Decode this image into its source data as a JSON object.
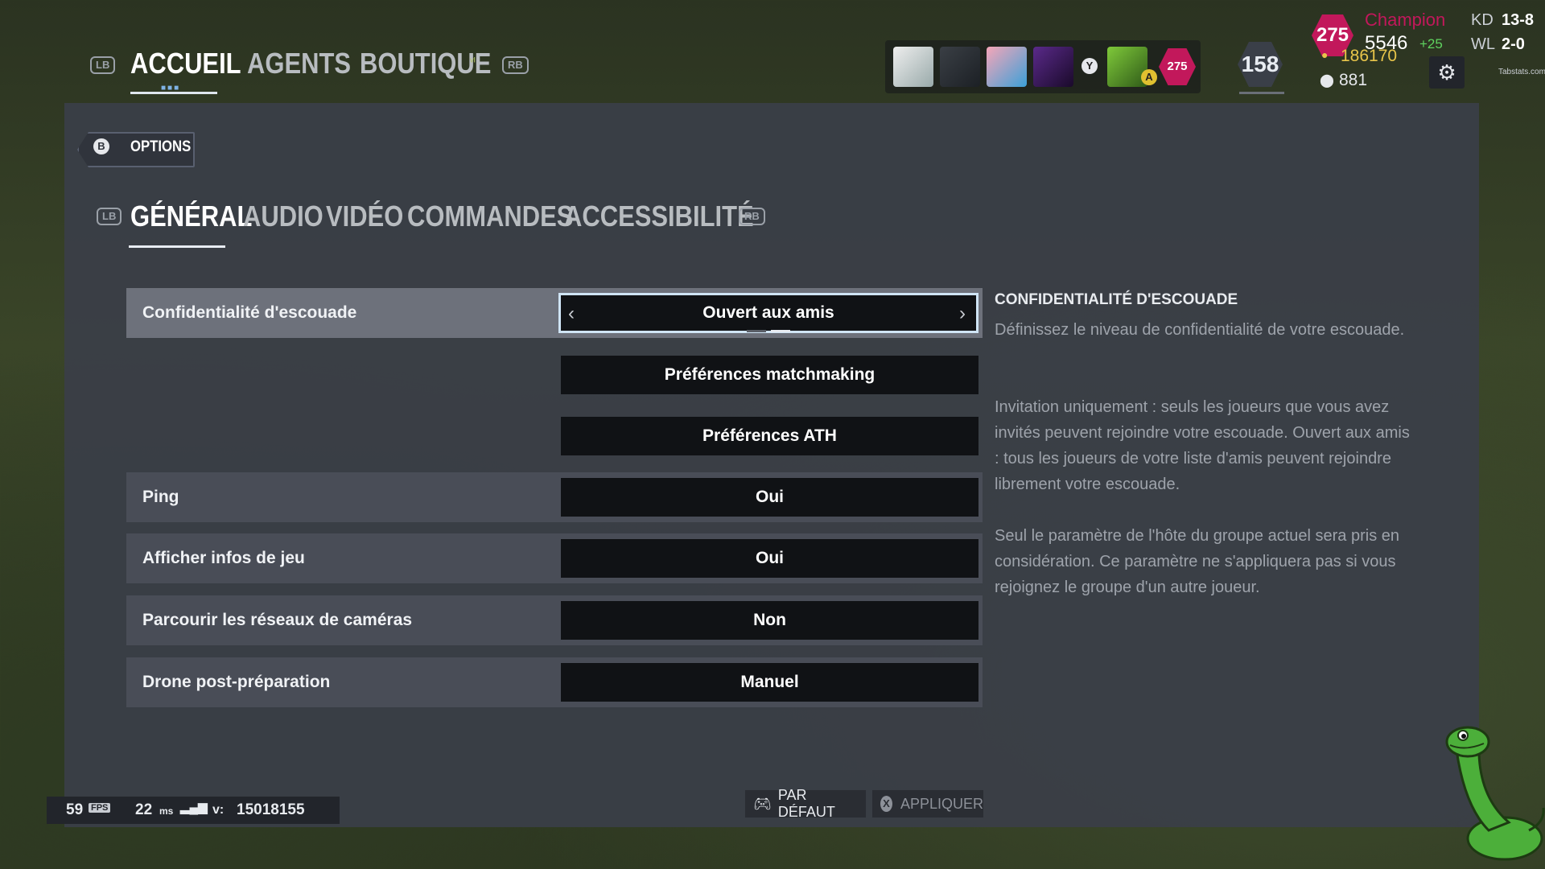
{
  "top_nav": {
    "lb": "LB",
    "rb": "RB",
    "tabs": [
      "ACCUEIL",
      "AGENTS",
      "BOUTIQUE"
    ]
  },
  "squad": {
    "avatar_y_label": "Y",
    "avatar_a_label": "A",
    "member_level": "275"
  },
  "player": {
    "level": "158",
    "rank_level": "275",
    "rank_name": "Champion",
    "mmr": "5546",
    "mmr_change": "+25",
    "renown": "186170",
    "credits": "881",
    "kd_label": "KD",
    "kd_value": "13-8",
    "wl_label": "WL",
    "wl_value": "2-0",
    "watermark": "Tabstats.com"
  },
  "options": {
    "back_key": "B",
    "title": "OPTIONS",
    "lb": "LB",
    "rb": "RB",
    "tabs": [
      "GÉNÉRAL",
      "AUDIO",
      "VIDÉO",
      "COMMANDES",
      "ACCESSIBILITÉ"
    ]
  },
  "settings": [
    {
      "label": "Confidentialité d'escouade",
      "value": "Ouvert aux amis"
    },
    {
      "label": "",
      "value": "Préférences matchmaking"
    },
    {
      "label": "",
      "value": "Préférences ATH"
    },
    {
      "label": "Ping",
      "value": "Oui"
    },
    {
      "label": "Afficher infos de jeu",
      "value": "Oui"
    },
    {
      "label": "Parcourir les réseaux de caméras",
      "value": "Non"
    },
    {
      "label": "Drone post-préparation",
      "value": "Manuel"
    }
  ],
  "description": {
    "title": "CONFIDENTIALITÉ D'ESCOUADE",
    "p1": "Définissez le niveau de confidentialité de votre escouade.",
    "p2": "Invitation uniquement  : seuls les joueurs que vous avez invités peuvent rejoindre votre escouade. Ouvert aux amis  : tous les joueurs de votre liste d'amis peuvent rejoindre librement votre escouade.",
    "p3": "Seul le paramètre de l'hôte du groupe actuel sera pris en considération. Ce paramètre ne s'appliquera pas si vous rejoignez le groupe d'un autre joueur."
  },
  "status": {
    "fps": "59",
    "fps_unit": "FPS",
    "ping": "22",
    "ping_unit": "ms",
    "version_label": "v:",
    "version": "15018155"
  },
  "footer": {
    "default_label": "PAR DÉFAUT",
    "apply_key": "X",
    "apply_label": "APPLIQUER"
  },
  "colors": {
    "accent": "#cfe4f5",
    "rank": "#c2185b",
    "mmr_up": "#5fd35f",
    "renown": "#e8c54a"
  }
}
